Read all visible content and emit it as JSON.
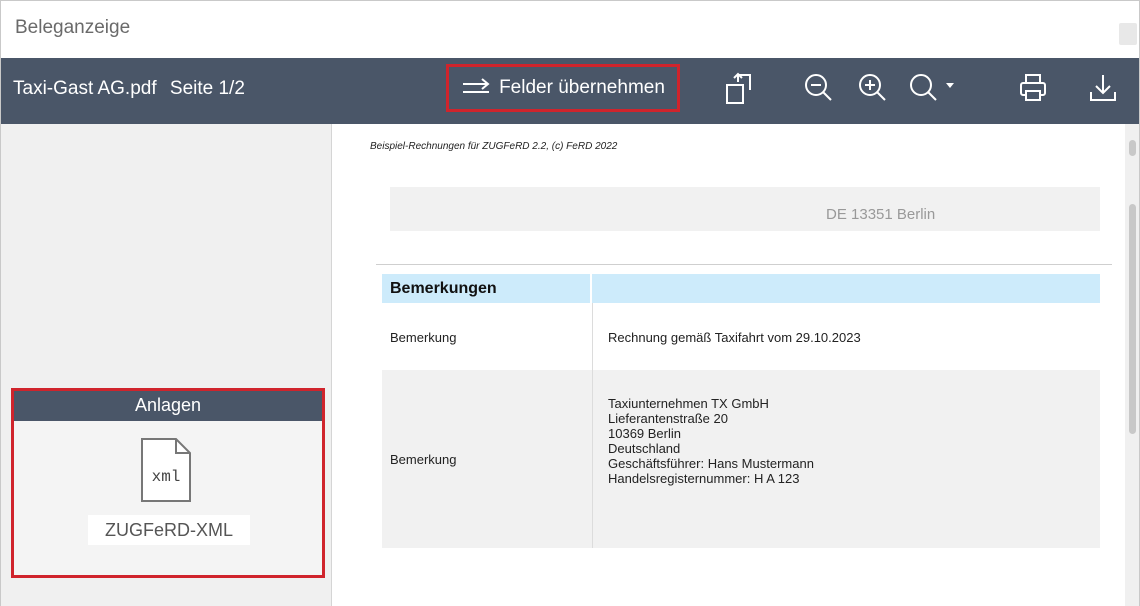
{
  "window": {
    "title": "Beleganzeige"
  },
  "toolbar": {
    "doc_name": "Taxi-Gast AG.pdf",
    "page_info": "Seite 1/2",
    "felder_label": "Felder übernehmen"
  },
  "attachments": {
    "header": "Anlagen",
    "file_icon_text": "xml",
    "file_label": "ZUGFeRD-XML"
  },
  "document": {
    "header_note": "Beispiel-Rechnungen für ZUGFeRD 2.2, (c) FeRD 2022",
    "address_city": "DE 13351 Berlin",
    "section_title": "Bemerkungen",
    "rows": [
      {
        "label": "Bemerkung",
        "value": [
          "Rechnung gemäß Taxifahrt vom 29.10.2023"
        ]
      },
      {
        "label": "Bemerkung",
        "value": [
          "Taxiunternehmen TX GmbH",
          "Lieferantenstraße 20",
          "10369 Berlin",
          "Deutschland",
          "Geschäftsführer: Hans Mustermann",
          "Handelsregisternummer: H A 123"
        ]
      }
    ]
  },
  "colors": {
    "toolbar_bg": "#4a5668",
    "highlight_border": "#d0242c",
    "section_header_bg": "#cdebfb"
  }
}
